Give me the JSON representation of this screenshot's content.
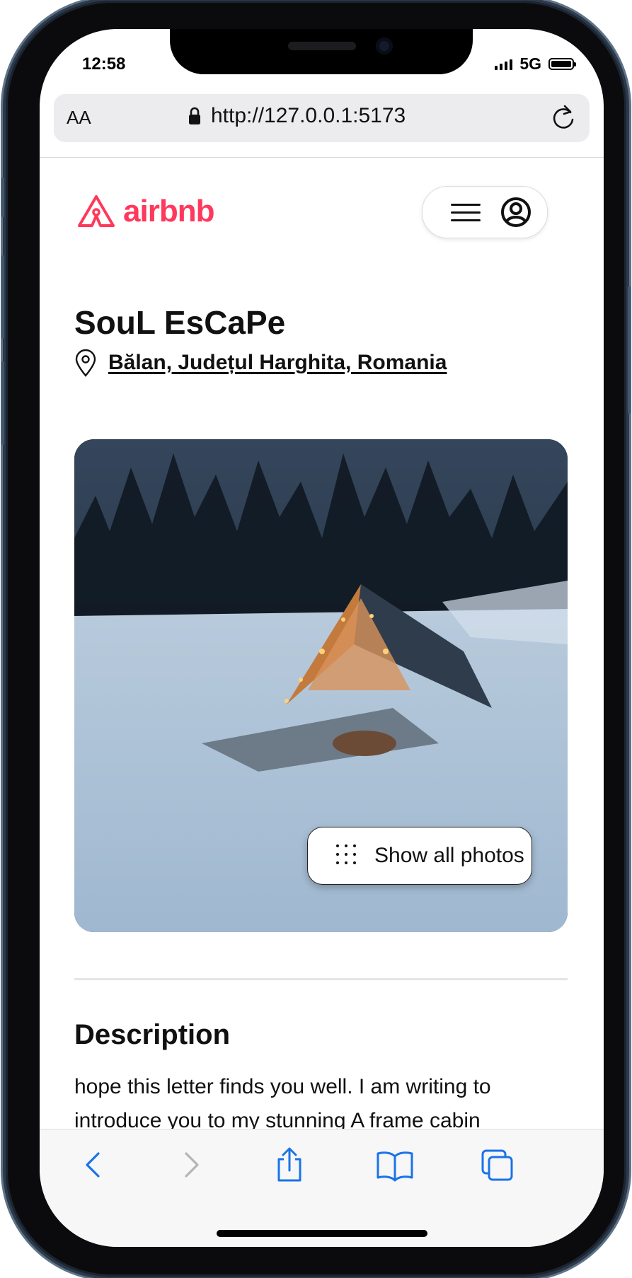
{
  "status_bar": {
    "time": "12:58",
    "network": "5G"
  },
  "browser": {
    "text_size_label": "AA",
    "url": "http://127.0.0.1:5173"
  },
  "header": {
    "logo_text": "airbnb"
  },
  "listing": {
    "title": "SouL EsCaPe",
    "location": "Bălan, Județul Harghita, Romania",
    "show_photos_label": "Show all photos"
  },
  "description": {
    "heading": "Description",
    "text": "hope this letter finds you well. I am writing to introduce you to my stunning A frame cabin"
  },
  "colors": {
    "brand": "#ff385c",
    "toolbar_accent": "#1a73e8"
  }
}
